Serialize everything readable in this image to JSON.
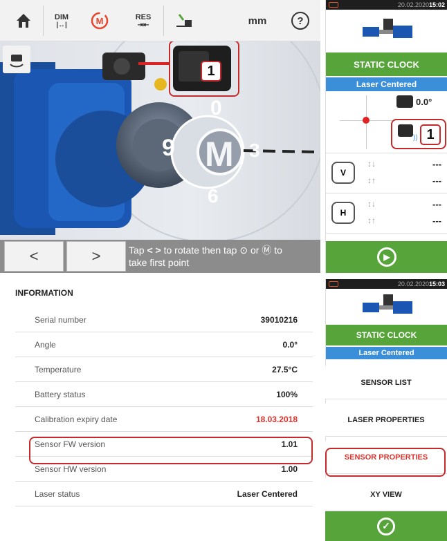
{
  "toolbar": {
    "home_icon": "home-icon",
    "dim_label": "DIM",
    "measure_label": "M",
    "res_label": "RES",
    "units_label": "mm",
    "help_label": "?"
  },
  "scene": {
    "dial_9": "9",
    "dial_0": "0",
    "dial_3": "3",
    "dial_6": "6",
    "measure_letter": "M",
    "callout_number": "1"
  },
  "bottom": {
    "prev_label": "<",
    "next_label": ">",
    "hint_line1": "Tap",
    "hint_line1b": "to rotate then tap",
    "hint_or": "or",
    "hint_to": "to",
    "hint_line2": "take first point"
  },
  "right_top": {
    "datetime": "20.02.2020",
    "time": "15:02",
    "mode_label": "STATIC CLOCK",
    "laser_status": "Laser Centered",
    "angle_value": "0.0°",
    "callout_number": "1",
    "v_value_1": "---",
    "v_value_2": "---",
    "h_value_1": "---",
    "h_value_2": "---",
    "v_label": "V",
    "h_label": "H"
  },
  "info": {
    "title": "INFORMATION",
    "rows": [
      {
        "label": "Serial number",
        "value": "39010216"
      },
      {
        "label": "Angle",
        "value": "0.0°"
      },
      {
        "label": "Temperature",
        "value": "27.5°C"
      },
      {
        "label": "Battery status",
        "value": "100%"
      },
      {
        "label": "Calibration expiry date",
        "value": "18.03.2018"
      },
      {
        "label": "Sensor FW version",
        "value": "1.01"
      },
      {
        "label": "Sensor HW version",
        "value": "1.00"
      },
      {
        "label": "Laser status",
        "value": "Laser Centered"
      }
    ]
  },
  "right_bottom": {
    "datetime": "20.02.2020",
    "time": "15:03",
    "mode_label": "STATIC CLOCK",
    "laser_status": "Laser Centered",
    "menu": [
      "SENSOR LIST",
      "LASER PROPERTIES",
      "SENSOR PROPERTIES",
      "XY VIEW"
    ]
  },
  "colors": {
    "accent_green": "#56a43a",
    "accent_blue": "#3b8fd8",
    "highlight_red": "#c42a2a",
    "expiry_red": "#e0312c"
  }
}
